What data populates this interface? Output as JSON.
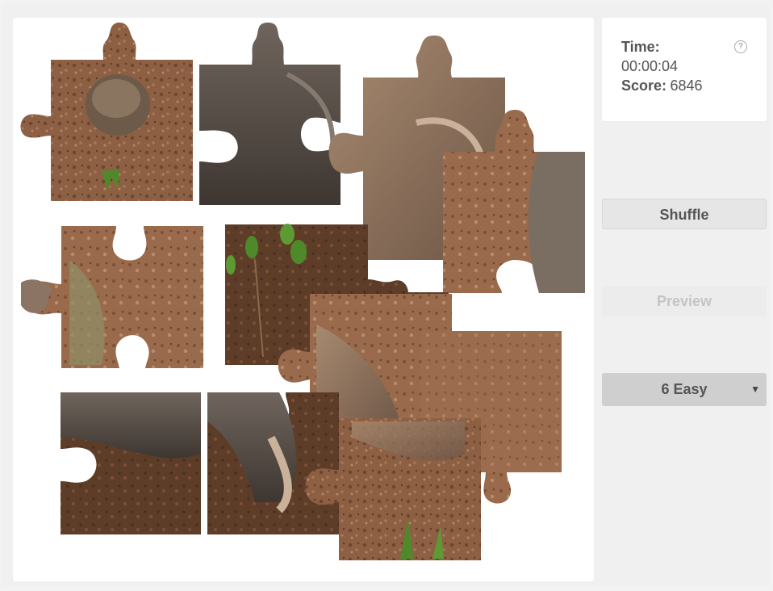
{
  "stats": {
    "time_label": "Time:",
    "time_value": "00:00:04",
    "score_label": "Score:",
    "score_value": "6846",
    "help_glyph": "?"
  },
  "buttons": {
    "shuffle_label": "Shuffle",
    "preview_label": "Preview",
    "level_value": "6 Easy",
    "level_caret": "▼"
  },
  "puzzle": {
    "piece_count_setting": "6 Easy",
    "image_subject": "animal digging in brown soil"
  },
  "colors": {
    "page_bg": "#f2f2f2",
    "board_bg": "#ffffff",
    "soil_light": "#9a6a4c",
    "soil_dark": "#6b4630",
    "fur_grey": "#6f655d",
    "fur_tan": "#a88a70",
    "leaf_green": "#4f8a2a",
    "text_grey": "#555555",
    "disabled_text": "#c4c4c4"
  }
}
